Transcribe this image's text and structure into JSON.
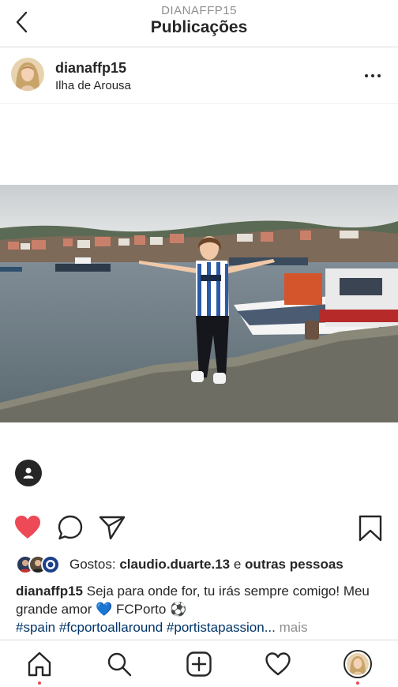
{
  "nav": {
    "username": "DIANAFFP15",
    "title": "Publicações"
  },
  "post": {
    "username": "dianaffp15",
    "location": "Ilha de Arousa"
  },
  "likes": {
    "prefix": "Gostos: ",
    "liker": "claudio.duarte.13",
    "connector": " e ",
    "others": "outras pessoas"
  },
  "caption": {
    "username": "dianaffp15",
    "text": " Seja para onde for, tu irás sempre comigo! Meu grande amor 💙 FCPorto ⚽",
    "hashtags": "#spain #fcportoallaround #portistapassion...",
    "more": " mais"
  },
  "icons": {
    "back": "chevron-left-icon",
    "more": "ellipsis-icon",
    "tag": "user-tag-icon",
    "like": "heart-filled-icon",
    "comment": "comment-icon",
    "share": "paper-plane-icon",
    "save": "bookmark-icon",
    "home": "home-icon",
    "search": "search-icon",
    "add": "add-post-icon",
    "activity": "heart-outline-icon",
    "profile": "profile-avatar-icon"
  },
  "colors": {
    "like_red": "#ed4956",
    "hashtag_blue": "#003569",
    "muted_gray": "#8e8e8e",
    "text": "#262626",
    "notification_dot": "#ed4956"
  }
}
